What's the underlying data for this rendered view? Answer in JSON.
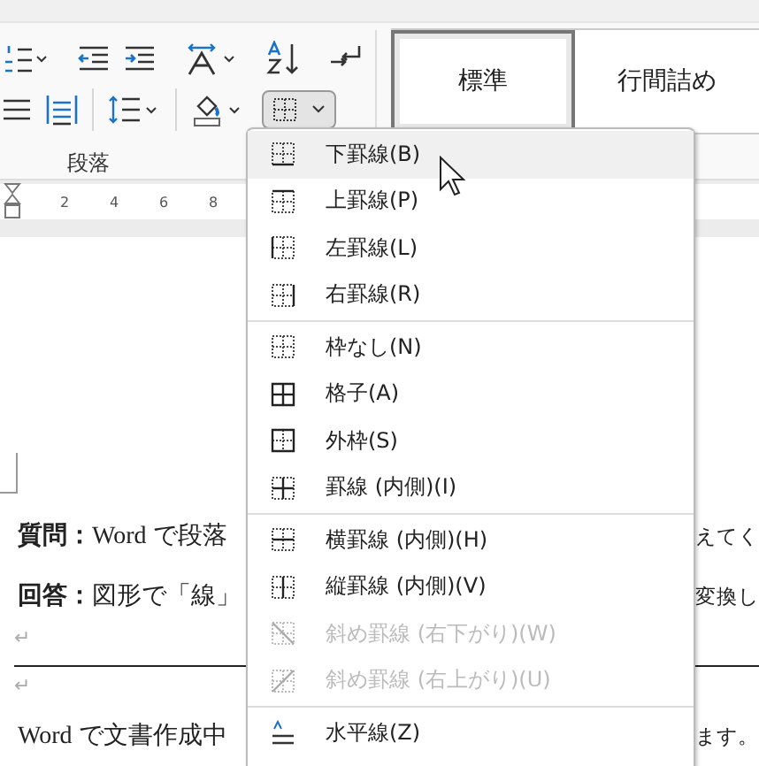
{
  "ribbon": {
    "group_label": "段落"
  },
  "styles": [
    {
      "label": "標準",
      "selected": true
    },
    {
      "label": "行間詰め",
      "selected": false
    }
  ],
  "ruler": {
    "ticks": [
      "2",
      "4",
      "6",
      "8"
    ]
  },
  "document": {
    "lines": [
      {
        "kind": "text",
        "left": "**質問：**Word で段落",
        "right": "えてく"
      },
      {
        "kind": "text",
        "left": "**回答：**図形で「線」",
        "right": "変換し"
      },
      {
        "kind": "mark",
        "left": "↵"
      },
      {
        "kind": "rule"
      },
      {
        "kind": "mark",
        "left": "↵"
      },
      {
        "kind": "text",
        "left": "Word で文書作成中",
        "right": "ます。"
      }
    ]
  },
  "menu": {
    "groups": [
      [
        {
          "kind": "bottom",
          "label": "下罫線(B)",
          "selected": true,
          "disabled": false
        },
        {
          "kind": "top",
          "label": "上罫線(P)",
          "selected": false,
          "disabled": false
        },
        {
          "kind": "left",
          "label": "左罫線(L)",
          "selected": false,
          "disabled": false
        },
        {
          "kind": "right",
          "label": "右罫線(R)",
          "selected": false,
          "disabled": false
        }
      ],
      [
        {
          "kind": "none",
          "label": "枠なし(N)",
          "selected": false,
          "disabled": false
        },
        {
          "kind": "all",
          "label": "格子(A)",
          "selected": false,
          "disabled": false
        },
        {
          "kind": "outside",
          "label": "外枠(S)",
          "selected": false,
          "disabled": false
        },
        {
          "kind": "inside",
          "label": "罫線 (内側)(I)",
          "selected": false,
          "disabled": false
        }
      ],
      [
        {
          "kind": "horizontal",
          "label": "横罫線 (内側)(H)",
          "selected": false,
          "disabled": false
        },
        {
          "kind": "vertical",
          "label": "縦罫線 (内側)(V)",
          "selected": false,
          "disabled": false
        },
        {
          "kind": "diagdown",
          "label": "斜め罫線 (右下がり)(W)",
          "selected": false,
          "disabled": true
        },
        {
          "kind": "diagup",
          "label": "斜め罫線 (右上がり)(U)",
          "selected": false,
          "disabled": true
        }
      ],
      [
        {
          "kind": "hline",
          "label": "水平線(Z)",
          "selected": false,
          "disabled": false
        }
      ]
    ]
  }
}
